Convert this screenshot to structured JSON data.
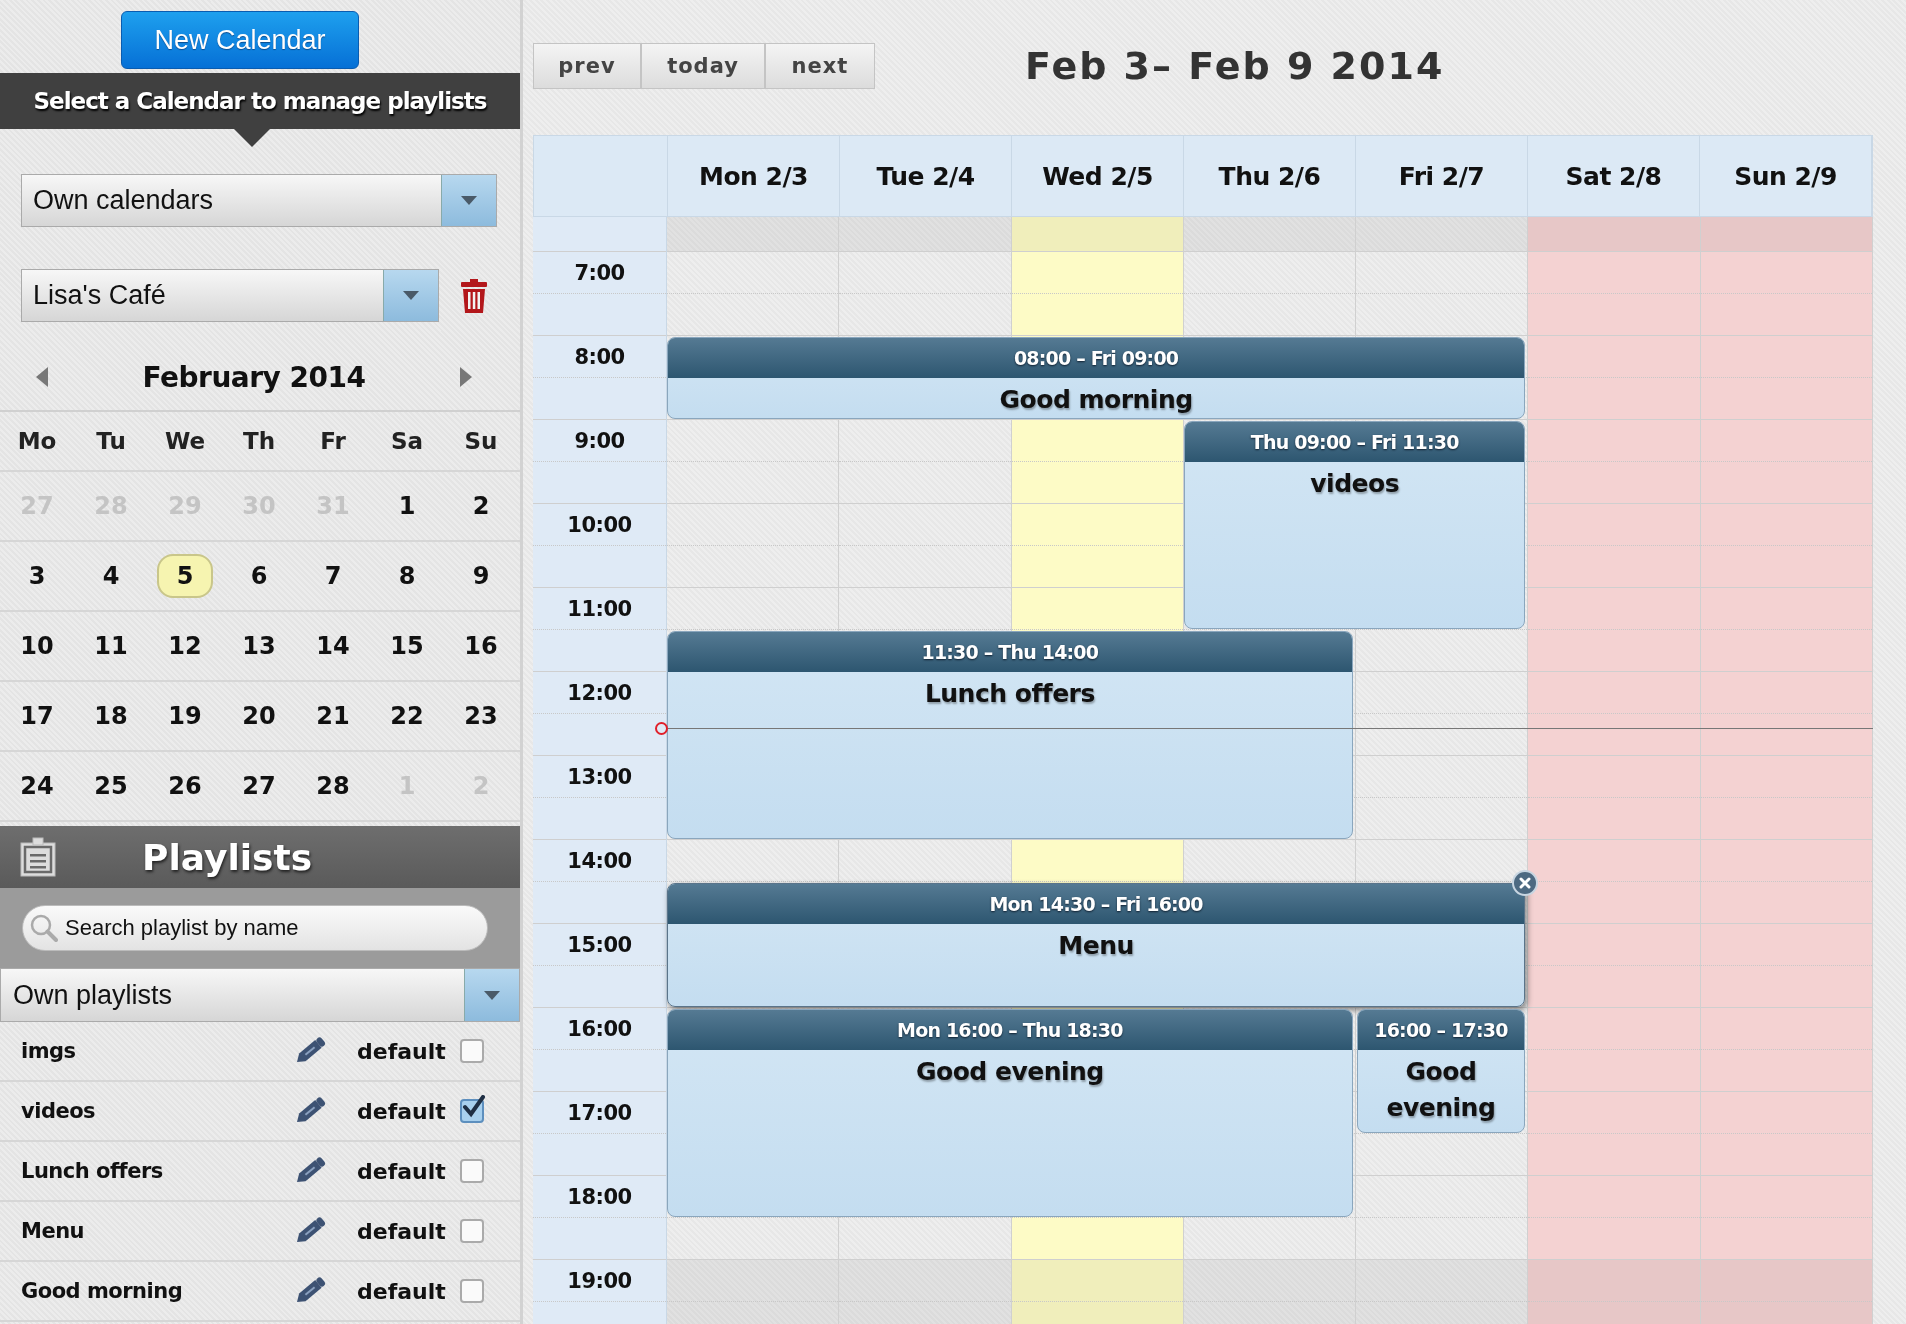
{
  "sidebar": {
    "new_button": "New Calendar",
    "banner": "Select a Calendar to manage playlists",
    "calendar_filter": "Own calendars",
    "calendar": "Lisa's Café"
  },
  "mini_calendar": {
    "month": "February 2014",
    "weekdays": [
      "Mo",
      "Tu",
      "We",
      "Th",
      "Fr",
      "Sa",
      "Su"
    ],
    "weeks": [
      [
        {
          "label": "27",
          "other_month": true,
          "today": false
        },
        {
          "label": "28",
          "other_month": true,
          "today": false
        },
        {
          "label": "29",
          "other_month": true,
          "today": false
        },
        {
          "label": "30",
          "other_month": true,
          "today": false
        },
        {
          "label": "31",
          "other_month": true,
          "today": false
        },
        {
          "label": "1",
          "other_month": false,
          "today": false
        },
        {
          "label": "2",
          "other_month": false,
          "today": false
        }
      ],
      [
        {
          "label": "3",
          "other_month": false,
          "today": false
        },
        {
          "label": "4",
          "other_month": false,
          "today": false
        },
        {
          "label": "5",
          "other_month": false,
          "today": true
        },
        {
          "label": "6",
          "other_month": false,
          "today": false
        },
        {
          "label": "7",
          "other_month": false,
          "today": false
        },
        {
          "label": "8",
          "other_month": false,
          "today": false
        },
        {
          "label": "9",
          "other_month": false,
          "today": false
        }
      ],
      [
        {
          "label": "10",
          "other_month": false,
          "today": false
        },
        {
          "label": "11",
          "other_month": false,
          "today": false
        },
        {
          "label": "12",
          "other_month": false,
          "today": false
        },
        {
          "label": "13",
          "other_month": false,
          "today": false
        },
        {
          "label": "14",
          "other_month": false,
          "today": false
        },
        {
          "label": "15",
          "other_month": false,
          "today": false
        },
        {
          "label": "16",
          "other_month": false,
          "today": false
        }
      ],
      [
        {
          "label": "17",
          "other_month": false,
          "today": false
        },
        {
          "label": "18",
          "other_month": false,
          "today": false
        },
        {
          "label": "19",
          "other_month": false,
          "today": false
        },
        {
          "label": "20",
          "other_month": false,
          "today": false
        },
        {
          "label": "21",
          "other_month": false,
          "today": false
        },
        {
          "label": "22",
          "other_month": false,
          "today": false
        },
        {
          "label": "23",
          "other_month": false,
          "today": false
        }
      ],
      [
        {
          "label": "24",
          "other_month": false,
          "today": false
        },
        {
          "label": "25",
          "other_month": false,
          "today": false
        },
        {
          "label": "26",
          "other_month": false,
          "today": false
        },
        {
          "label": "27",
          "other_month": false,
          "today": false
        },
        {
          "label": "28",
          "other_month": false,
          "today": false
        },
        {
          "label": "1",
          "other_month": true,
          "today": false
        },
        {
          "label": "2",
          "other_month": true,
          "today": false
        }
      ]
    ]
  },
  "playlists": {
    "title": "Playlists",
    "search": {
      "placeholder": "Search playlist by name"
    },
    "filter": "Own playlists",
    "items": [
      {
        "name": "imgs",
        "default_label": "default",
        "checked": false
      },
      {
        "name": "videos",
        "default_label": "default",
        "checked": true
      },
      {
        "name": "Lunch offers",
        "default_label": "default",
        "checked": false
      },
      {
        "name": "Menu",
        "default_label": "default",
        "checked": false
      },
      {
        "name": "Good morning",
        "default_label": "default",
        "checked": false
      }
    ]
  },
  "toolbar": {
    "buttons": [
      "prev",
      "today",
      "next"
    ],
    "title": "Feb 3– Feb 9 2014"
  },
  "week": {
    "days": [
      {
        "label": "Mon 2/3",
        "today": false,
        "weekend": false
      },
      {
        "label": "Tue 2/4",
        "today": false,
        "weekend": false
      },
      {
        "label": "Wed 2/5",
        "today": true,
        "weekend": false
      },
      {
        "label": "Thu 2/6",
        "today": false,
        "weekend": false
      },
      {
        "label": "Fri 2/7",
        "today": false,
        "weekend": false
      },
      {
        "label": "Sat 2/8",
        "today": false,
        "weekend": true
      },
      {
        "label": "Sun 2/9",
        "today": false,
        "weekend": true
      }
    ],
    "hours": [
      "7:00",
      "8:00",
      "9:00",
      "10:00",
      "11:00",
      "12:00",
      "13:00",
      "14:00",
      "15:00",
      "16:00",
      "17:00",
      "18:00",
      "19:00"
    ],
    "events": [
      {
        "time": "08:00 – Fri 09:00",
        "title": "Good morning",
        "selected": false
      },
      {
        "time": "Thu 09:00 – Fri 11:30",
        "title": "videos",
        "selected": false
      },
      {
        "time": "11:30 – Thu 14:00",
        "title": "Lunch offers",
        "selected": false
      },
      {
        "time": "Mon 14:30 – Fri 16:00",
        "title": "Menu",
        "selected": true
      },
      {
        "time": "Mon 16:00 – Thu 18:30",
        "title": "Good evening",
        "selected": false
      },
      {
        "time": "16:00 – 17:30",
        "title": "Good evening",
        "selected": false
      }
    ]
  }
}
